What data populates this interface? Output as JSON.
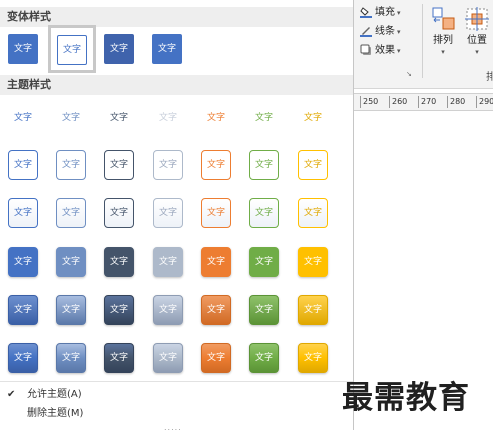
{
  "gallery": {
    "variant_header": "变体样式",
    "theme_header": "主题样式",
    "swatch_label": "文字",
    "variant_styles": [
      {
        "bg": "#4472c4",
        "border": "#4472c4",
        "color": "#ffffff"
      },
      {
        "bg": "#ffffff",
        "border": "#4472c4",
        "color": "#4472c4"
      },
      {
        "bg": "#3f63ac",
        "border": "#3f63ac",
        "color": "#ffffff"
      },
      {
        "bg": "#4472c4",
        "border": "#4472c4",
        "color": "#ffffff"
      }
    ],
    "theme_columns": [
      {
        "name": "blue",
        "main": "#4472c4",
        "light": "#6d90cf",
        "dark": "#3a5fa6",
        "text": "#4472c4"
      },
      {
        "name": "blue-gray",
        "main": "#6f8fc2",
        "light": "#a8bde0",
        "dark": "#5a78a9",
        "text": "#6f8fc2"
      },
      {
        "name": "navy",
        "main": "#44546a",
        "light": "#5b739c",
        "dark": "#34435a",
        "text": "#44546a"
      },
      {
        "name": "light-gray-blue",
        "main": "#adb9ca",
        "light": "#cad4e4",
        "dark": "#8e9cb3",
        "text": "#9aa7bd"
      },
      {
        "name": "orange",
        "main": "#ed7d31",
        "light": "#f09b62",
        "dark": "#d16a24",
        "text": "#ed7d31"
      },
      {
        "name": "green",
        "main": "#70ad47",
        "light": "#8fc26b",
        "dark": "#5b9336",
        "text": "#70ad47"
      },
      {
        "name": "gold",
        "main": "#ffc000",
        "light": "#ffd24d",
        "dark": "#e0a800",
        "text": "#e0a800"
      }
    ],
    "menu": {
      "allow_theme": "允许主题(A)",
      "allow_theme_checked": "✔",
      "delete_theme": "删除主题(M)",
      "grip": "....."
    }
  },
  "ribbon": {
    "fill_label": "填充",
    "line_label": "线条",
    "effect_label": "效果",
    "dropdown_arrow": "▾",
    "arrange_label": "排列",
    "position_label": "位置",
    "group_fragment": "排",
    "launcher": "↘"
  },
  "ruler": {
    "ticks": [
      "250",
      "260",
      "270",
      "280",
      "290"
    ]
  },
  "watermark": "最需教育"
}
